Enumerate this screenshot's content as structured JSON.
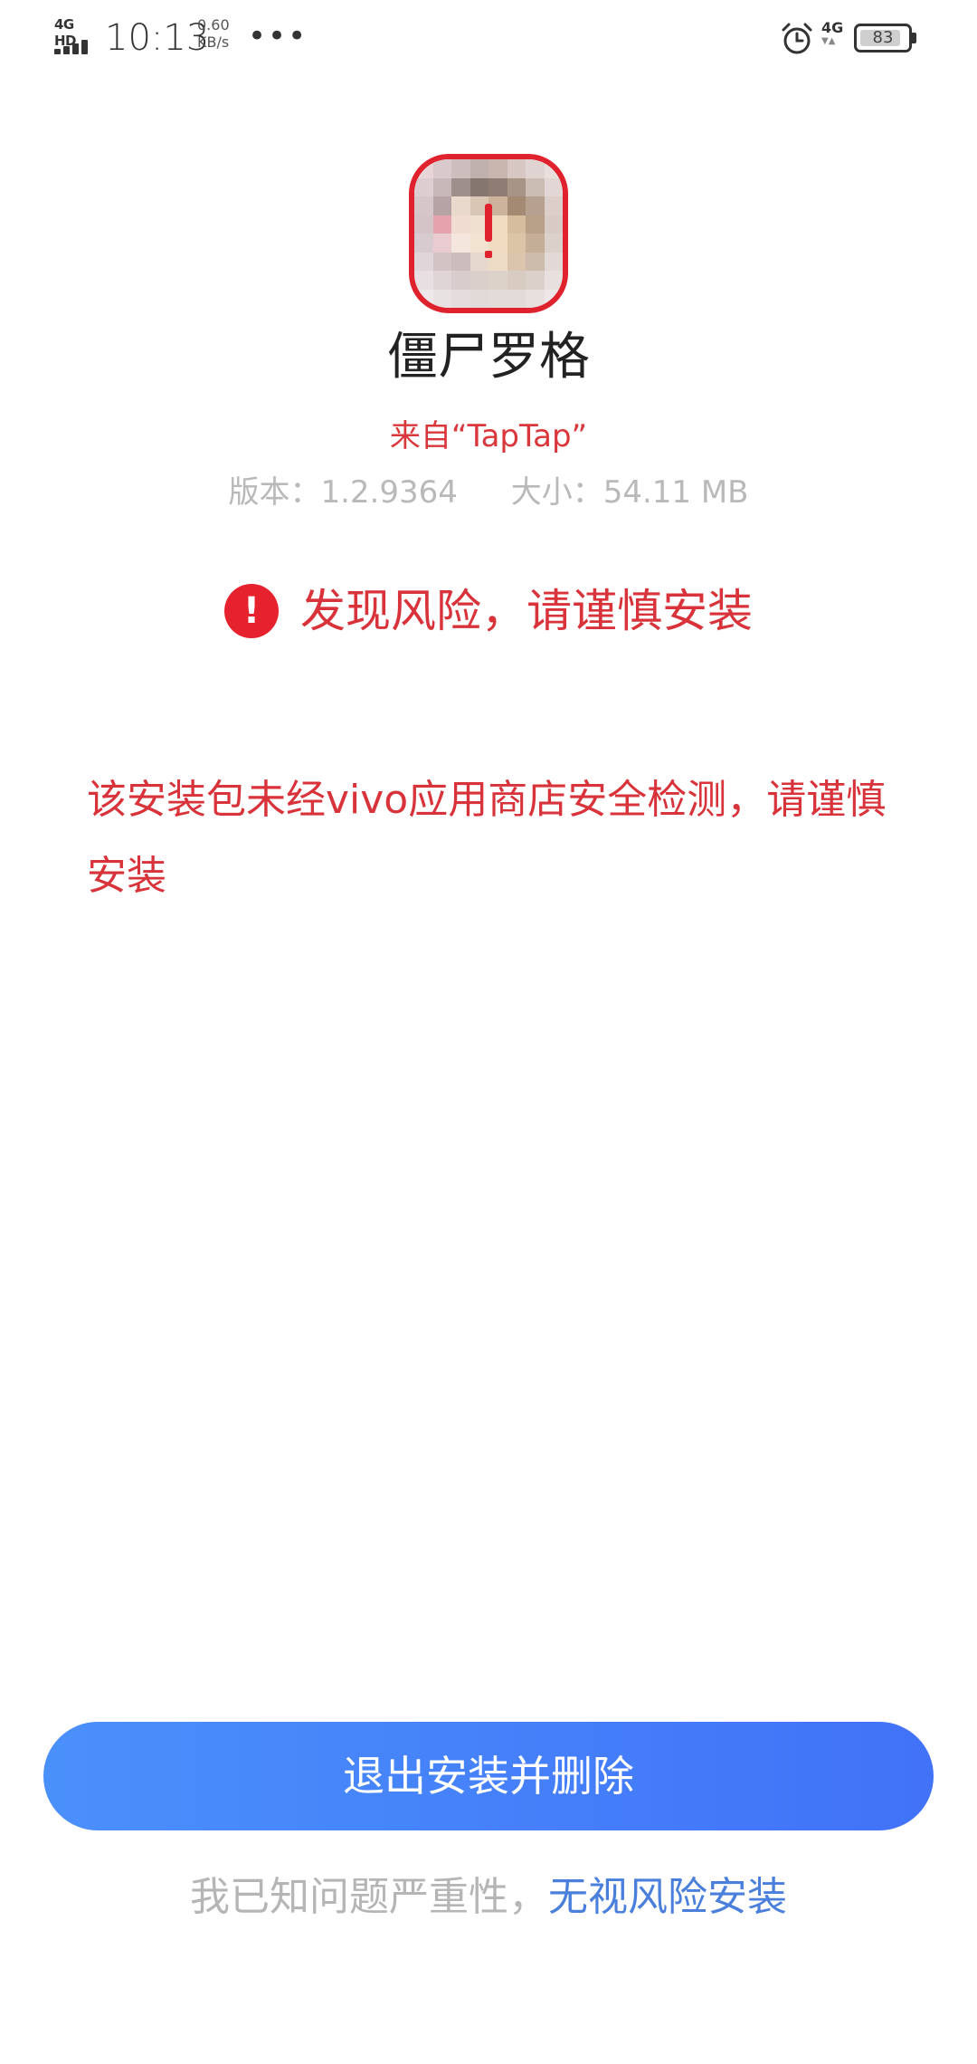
{
  "status_bar": {
    "network_type": "4G HD",
    "time": "10:13",
    "speed_value": "0.60",
    "speed_unit": "KB/s",
    "more_icon": "more-dots-icon",
    "alarm_icon": "alarm-clock-icon",
    "mobile_data": "4G",
    "battery": "83"
  },
  "app": {
    "icon": "app-icon-pixelated",
    "name": "僵尸罗格",
    "source": "来自“TapTap”",
    "version_text": "版本：1.2.9364",
    "size_text": "大小：54.11 MB"
  },
  "risk": {
    "icon": "exclamation-circle-icon",
    "title": "发现风险，请谨慎安装",
    "description": "该安装包未经vivo应用商店安全检测，请谨慎安装"
  },
  "actions": {
    "exit_button_label": "退出安装并删除",
    "ignore_prefix": "我已知问题严重性，",
    "ignore_link": "无视风险安装"
  },
  "colors": {
    "risk_red": "#d8333a",
    "button_blue": "#4a90fb",
    "link_blue": "#4a7fdc"
  }
}
